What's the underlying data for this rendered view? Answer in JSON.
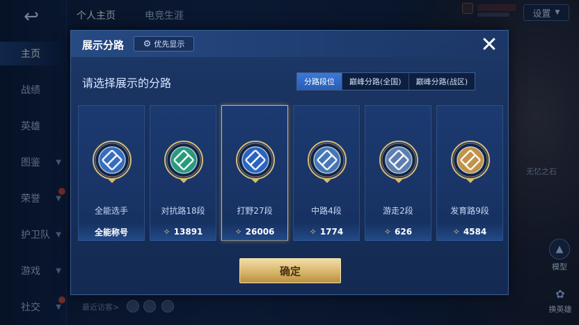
{
  "background": {
    "back_icon": "back-arrow-icon",
    "nav": [
      {
        "label": "主页",
        "active": true
      },
      {
        "label": "战绩"
      },
      {
        "label": "英雄"
      },
      {
        "label": "图鉴"
      },
      {
        "label": "荣誉"
      },
      {
        "label": "护卫队"
      },
      {
        "label": "游戏"
      },
      {
        "label": "社交"
      }
    ],
    "top_tabs": [
      "个人主页",
      "电竞生涯"
    ],
    "settings_label": "设置",
    "recent_visitors_label": "最近访客>",
    "model_label": "模型",
    "swap_hero_label": "换英雄",
    "hero_label": "无忆之石"
  },
  "modal": {
    "title": "展示分路",
    "priority_label": "优先显示",
    "subtitle": "请选择展示的分路",
    "segments": [
      {
        "label": "分路段位",
        "active": true
      },
      {
        "label": "巅峰分路(全国)",
        "active": false
      },
      {
        "label": "巅峰分路(战区)",
        "active": false
      }
    ],
    "cards": [
      {
        "name": "全能选手",
        "value": "全能称号",
        "icon": "all-round-emblem",
        "color": "#3d7ad1",
        "selected": false,
        "show_value_icon": false
      },
      {
        "name": "对抗路18段",
        "value": "13891",
        "icon": "clash-lane-emblem",
        "color": "#2fae86",
        "selected": false,
        "show_value_icon": true
      },
      {
        "name": "打野27段",
        "value": "26006",
        "icon": "jungle-emblem",
        "color": "#2f6fd6",
        "selected": true,
        "show_value_icon": true
      },
      {
        "name": "中路4段",
        "value": "1774",
        "icon": "mid-lane-emblem",
        "color": "#4f86c8",
        "selected": false,
        "show_value_icon": true
      },
      {
        "name": "游走2段",
        "value": "626",
        "icon": "roam-emblem",
        "color": "#6b8fc2",
        "selected": false,
        "show_value_icon": true
      },
      {
        "name": "发育路9段",
        "value": "4584",
        "icon": "farm-lane-emblem",
        "color": "#e0a64a",
        "selected": false,
        "show_value_icon": true
      }
    ],
    "confirm_label": "确定",
    "close_icon": "close-icon"
  }
}
